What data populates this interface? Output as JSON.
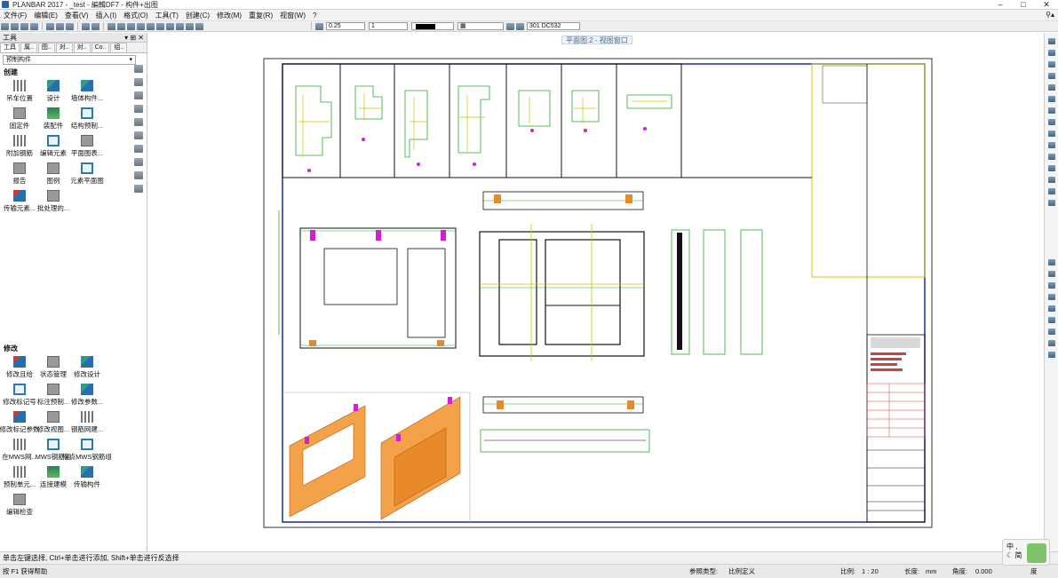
{
  "window": {
    "title": "PLANBAR 2017 - _test - 編輯DF7 - 构件+出图"
  },
  "menu": [
    "文件(F)",
    "编辑(E)",
    "查看(V)",
    "插入(I)",
    "格式(O)",
    "工具(T)",
    "创建(C)",
    "修改(M)",
    "重复(R)",
    "视窗(W)",
    "?"
  ],
  "toolbar": {
    "pen": "0.25",
    "line": "1",
    "layer": "301 DC532"
  },
  "panel": {
    "title": "工具",
    "tabs": [
      "工具",
      "属..",
      "图..",
      "对..",
      "对..",
      "Co..",
      "组.."
    ],
    "category": "预制构件",
    "create_title": "创建",
    "create_tools": [
      "吊车位置",
      "设计",
      "墙体构件...",
      "固定件",
      "装配件",
      "结构预制...",
      "附加钢筋",
      "编辑元素",
      "平面图表...",
      "报告",
      "图例",
      "元素平面图",
      "传输元素...",
      "批处理的..."
    ],
    "modify_title": "修改",
    "modify_tools": [
      "修改且给",
      "状态管理",
      "修改设计",
      "修改标记号",
      "标注预制...",
      "修改参数...",
      "修改标记参数",
      "修改视图...",
      "钢筋网建...",
      "在MWS网...",
      "MWS钢筋组",
      "指点MWS钢筋组",
      "预制单元...",
      "连接建模",
      "传输构件",
      "编辑检查"
    ]
  },
  "viewport": {
    "tab": "平面图:2 - 视图窗口"
  },
  "status": {
    "hint": "单击左键选择, Ctrl+单击进行添加, Shift+单击进行反选择",
    "help": "按 F1 获得帮助",
    "ref_label": "参照类型:",
    "ref_value": "比例定义",
    "scale_label": "比例:",
    "scale_value": "1 : 20",
    "length_label": "长度:",
    "length_value": "mm",
    "angle_label": "角度:",
    "angle_value": "0.000",
    "unit_value": "度"
  },
  "ime": {
    "line1": "中 ,",
    "line2": "☾ 简"
  },
  "colors": {
    "accent": "#2a6da8",
    "orange": "#e8892a",
    "green": "#2fa52f",
    "yellow": "#c8c800"
  }
}
